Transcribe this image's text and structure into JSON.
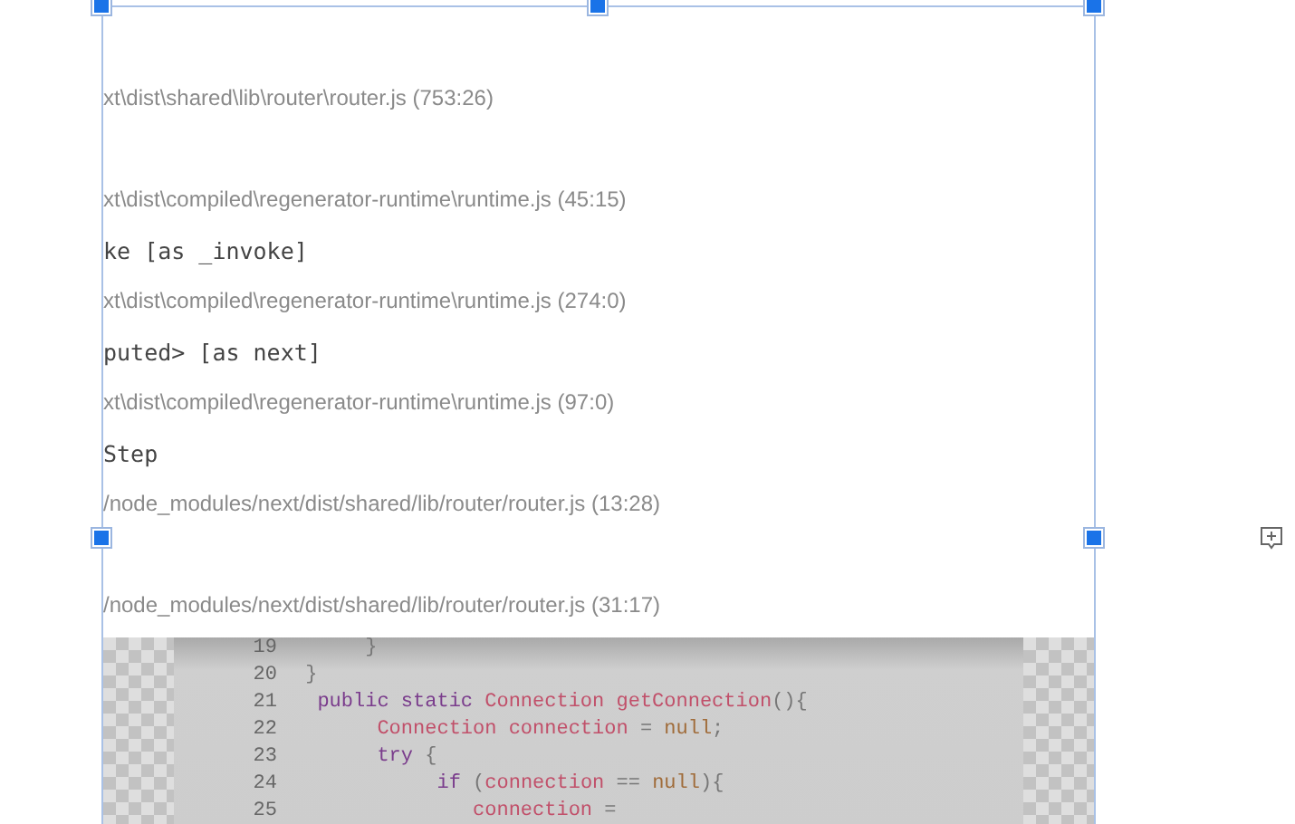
{
  "stack_frames": [
    {
      "location": "xt\\dist\\shared\\lib\\router\\router.js (753:26)"
    },
    {
      "location": "xt\\dist\\compiled\\regenerator-runtime\\runtime.js (45:15)"
    },
    {
      "function": "ke [as _invoke]",
      "location": "xt\\dist\\compiled\\regenerator-runtime\\runtime.js (274:0)"
    },
    {
      "function": "puted> [as next]",
      "location": "xt\\dist\\compiled\\regenerator-runtime\\runtime.js (97:0)"
    },
    {
      "function": "Step",
      "location": "/node_modules/next/dist/shared/lib/router/router.js (13:28)"
    },
    {
      "location": "/node_modules/next/dist/shared/lib/router/router.js (31:17)"
    }
  ],
  "code_image": {
    "lines": [
      {
        "number": "19",
        "tokens": [
          {
            "kind": "plain",
            "text": "      }"
          }
        ]
      },
      {
        "number": "20",
        "tokens": [
          {
            "kind": "plain",
            "text": " }"
          }
        ]
      },
      {
        "number": "21",
        "tokens": [
          {
            "kind": "keyword",
            "text": "  public static "
          },
          {
            "kind": "ident",
            "text": "Connection getConnection"
          },
          {
            "kind": "plain",
            "text": "(){"
          }
        ]
      },
      {
        "number": "22",
        "tokens": [
          {
            "kind": "ident",
            "text": "       Connection connection "
          },
          {
            "kind": "plain",
            "text": "= "
          },
          {
            "kind": "literal",
            "text": "null"
          },
          {
            "kind": "plain",
            "text": ";"
          }
        ]
      },
      {
        "number": "23",
        "tokens": [
          {
            "kind": "keyword",
            "text": "       try "
          },
          {
            "kind": "plain",
            "text": "{"
          }
        ]
      },
      {
        "number": "24",
        "tokens": [
          {
            "kind": "keyword",
            "text": "            if "
          },
          {
            "kind": "plain",
            "text": "("
          },
          {
            "kind": "ident",
            "text": "connection "
          },
          {
            "kind": "plain",
            "text": "== "
          },
          {
            "kind": "literal",
            "text": "null"
          },
          {
            "kind": "plain",
            "text": "){"
          }
        ]
      },
      {
        "number": "25",
        "tokens": [
          {
            "kind": "ident",
            "text": "               connection "
          },
          {
            "kind": "plain",
            "text": "="
          }
        ]
      }
    ]
  }
}
